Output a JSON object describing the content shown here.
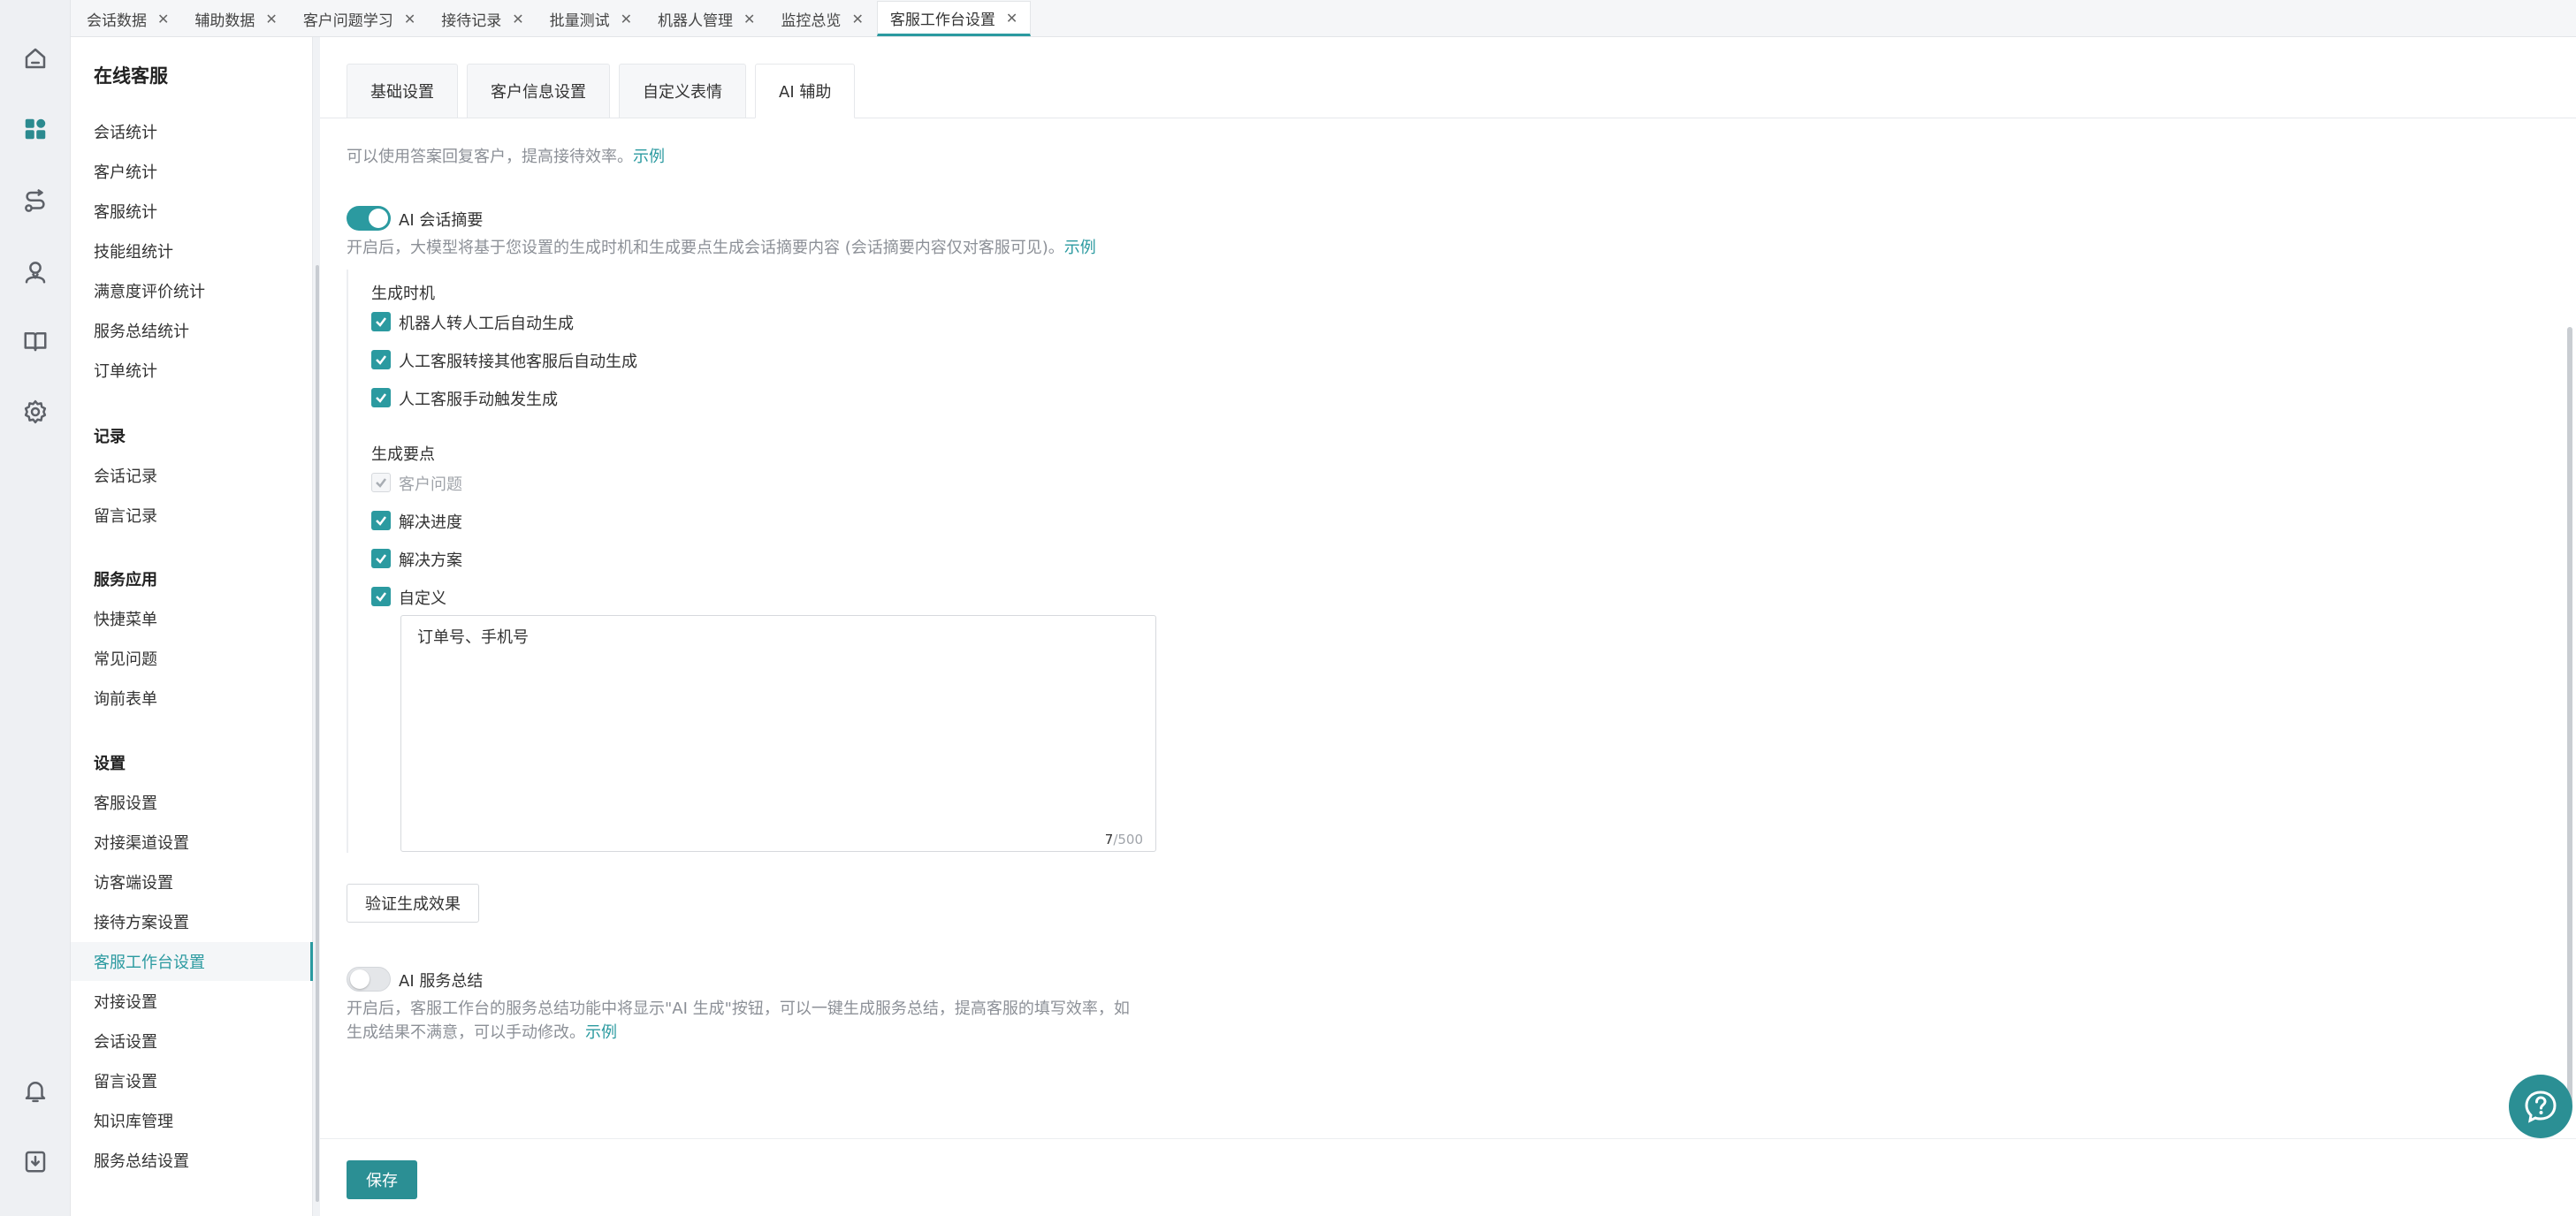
{
  "tabs": [
    {
      "label": "会话数据"
    },
    {
      "label": "辅助数据"
    },
    {
      "label": "客户问题学习"
    },
    {
      "label": "接待记录"
    },
    {
      "label": "批量测试"
    },
    {
      "label": "机器人管理"
    },
    {
      "label": "监控总览"
    },
    {
      "label": "客服工作台设置",
      "active": true
    }
  ],
  "rail_icons": [
    "home-icon",
    "dashboard-icon",
    "route-icon",
    "agent-icon",
    "book-icon",
    "gear-icon",
    "bell-icon",
    "download-icon"
  ],
  "nav": {
    "title": "在线客服",
    "stats": [
      "会话统计",
      "客户统计",
      "客服统计",
      "技能组统计",
      "满意度评价统计",
      "服务总结统计",
      "订单统计"
    ],
    "records_title": "记录",
    "records": [
      "会话记录",
      "留言记录"
    ],
    "apps_title": "服务应用",
    "apps": [
      "快捷菜单",
      "常见问题",
      "询前表单"
    ],
    "settings_title": "设置",
    "settings": [
      "客服设置",
      "对接渠道设置",
      "访客端设置",
      "接待方案设置",
      "客服工作台设置",
      "对接设置",
      "会话设置",
      "留言设置",
      "知识库管理",
      "服务总结设置"
    ],
    "active": "客服工作台设置"
  },
  "subtabs": [
    "基础设置",
    "客户信息设置",
    "自定义表情",
    "AI 辅助"
  ],
  "active_subtab": "AI 辅助",
  "top_desc": {
    "text": "可以使用答案回复客户，提高接待效率。",
    "link": "示例"
  },
  "summary": {
    "toggle_label": "AI 会话摘要",
    "enabled": true,
    "desc": "开启后，大模型将基于您设置的生成时机和生成要点生成会话摘要内容 (会话摘要内容仅对客服可见)。",
    "link": "示例",
    "timing_title": "生成时机",
    "timing": [
      {
        "label": "机器人转人工后自动生成",
        "checked": true
      },
      {
        "label": "人工客服转接其他客服后自动生成",
        "checked": true
      },
      {
        "label": "人工客服手动触发生成",
        "checked": true
      }
    ],
    "points_title": "生成要点",
    "points": [
      {
        "label": "客户问题",
        "checked": true,
        "disabled": true
      },
      {
        "label": "解决进度",
        "checked": true
      },
      {
        "label": "解决方案",
        "checked": true
      },
      {
        "label": "自定义",
        "checked": true
      }
    ],
    "custom_value": "订单号、手机号",
    "count_current": "7",
    "count_max": "/500",
    "verify_button": "验证生成效果"
  },
  "service_summary": {
    "toggle_label": "AI 服务总结",
    "enabled": false,
    "desc_line1": "开启后，客服工作台的服务总结功能中将显示\"AI 生成\"按钮，可以一键生成服务总结，提高客服的填写效率，如",
    "desc_line2": "生成结果不满意，可以手动修改。",
    "link": "示例"
  },
  "save_button": "保存",
  "colors": {
    "accent": "#2b9aa0",
    "primary_button": "#2b8f94"
  }
}
